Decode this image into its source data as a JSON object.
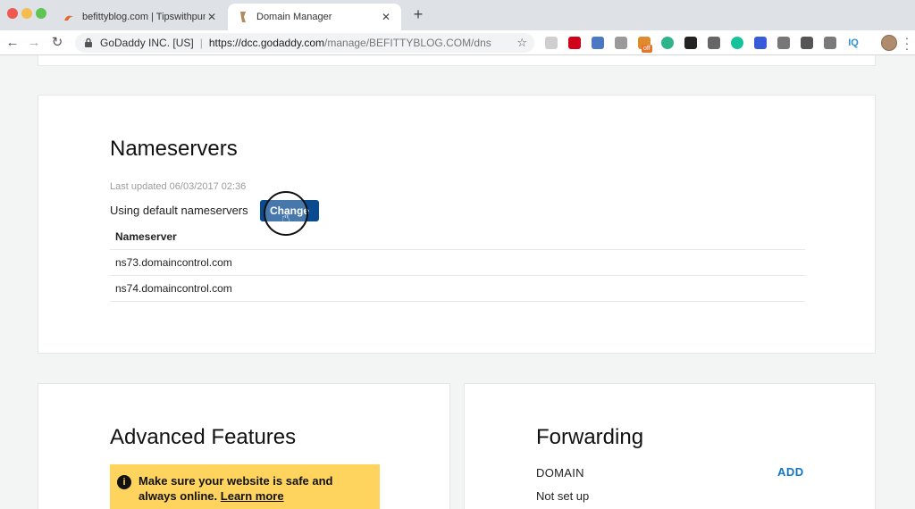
{
  "browser": {
    "tabs": [
      {
        "title": "befittyblog.com | Tipswithpunc",
        "active": false
      },
      {
        "title": "Domain Manager",
        "active": true
      }
    ],
    "omnibox": {
      "org": "GoDaddy INC. [US]",
      "host": "https://dcc.godaddy.com",
      "path": "/manage/BEFITTYBLOG.COM/dns"
    },
    "extensions": [
      {
        "icon": "extension-icon-1",
        "color": "#cfcfcf"
      },
      {
        "icon": "opera-icon",
        "color": "#d0021b"
      },
      {
        "icon": "extension-icon-3",
        "color": "#4a78c2"
      },
      {
        "icon": "extension-icon-4",
        "color": "#9a9a9a"
      },
      {
        "icon": "extension-icon-5",
        "color": "#e08a2e"
      },
      {
        "icon": "extension-icon-6",
        "color": "#2fb38a"
      },
      {
        "icon": "extension-icon-7",
        "color": "#222222"
      },
      {
        "icon": "extension-icon-8",
        "color": "#666666"
      },
      {
        "icon": "grammarly-icon",
        "color": "#15c39a"
      },
      {
        "icon": "extension-icon-10",
        "color": "#3a5bd9"
      },
      {
        "icon": "camera-icon",
        "color": "#777777"
      },
      {
        "icon": "extension-icon-12",
        "color": "#555555"
      },
      {
        "icon": "extension-icon-13",
        "color": "#7a7a7a"
      },
      {
        "icon": "iq-icon",
        "color": "#2f8fd6"
      }
    ],
    "ext_badge": "off"
  },
  "nameservers": {
    "title": "Nameservers",
    "last_updated": "Last updated 06/03/2017 02:36",
    "using": "Using default nameservers",
    "change_label": "Change",
    "column_header": "Nameserver",
    "rows": [
      "ns73.domaincontrol.com",
      "ns74.domaincontrol.com"
    ]
  },
  "advanced": {
    "title": "Advanced Features",
    "alert_text": "Make sure your website is safe and always online.",
    "learn_more": "Learn more"
  },
  "forwarding": {
    "title": "Forwarding",
    "domain_label": "DOMAIN",
    "add_label": "ADD",
    "status": "Not set up"
  },
  "colors": {
    "primary_button": "#0a4b8f",
    "alert_bg": "#fed45e",
    "link_blue": "#1276c6"
  }
}
